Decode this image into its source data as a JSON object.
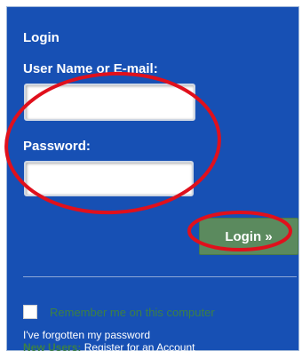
{
  "login": {
    "title": "Login",
    "username_label": "User Name or E-mail:",
    "username_value": "",
    "password_label": "Password:",
    "password_value": "",
    "submit_label": "Login »",
    "remember_label": "Remember me on this computer",
    "remember_checked": false,
    "forgot_password": "I've forgotten my password",
    "new_users_label": "New Users:",
    "register_link": "Register for an Account"
  },
  "colors": {
    "panel_background": "#1750b4",
    "login_button": "#5b8a5e",
    "green_accent": "#3c8045",
    "annotation_red": "#e0101c"
  },
  "annotations": [
    {
      "name": "red-circle-credentials",
      "shape": "ellipse"
    },
    {
      "name": "red-circle-login-button",
      "shape": "ellipse"
    }
  ]
}
